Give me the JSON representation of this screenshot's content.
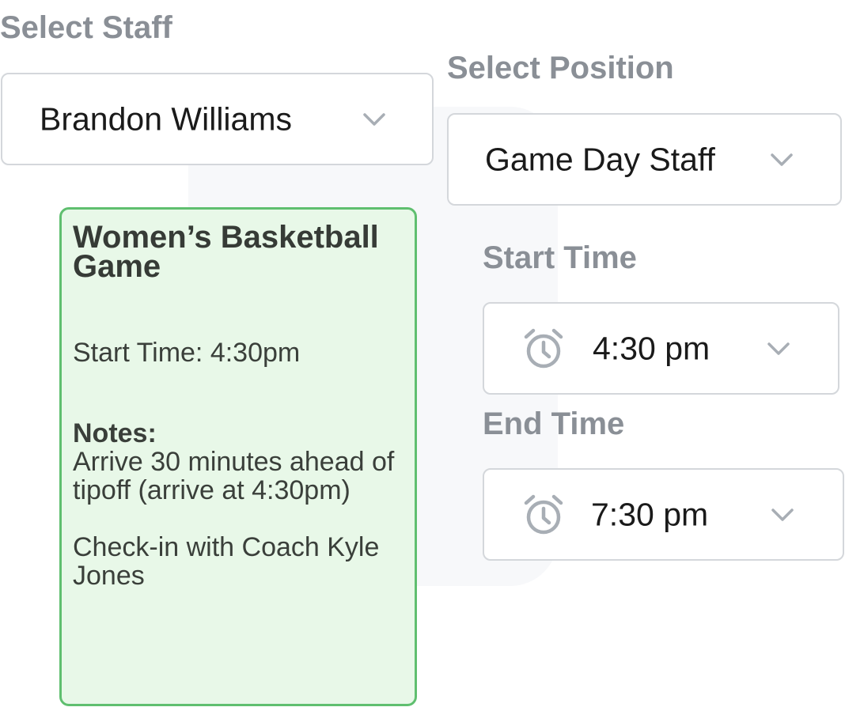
{
  "staff": {
    "label": "Select Staff",
    "value": "Brandon Williams"
  },
  "position": {
    "label": "Select Position",
    "value": "Game Day Staff"
  },
  "start_time": {
    "label": "Start Time",
    "value": "4:30 pm"
  },
  "end_time": {
    "label": "End Time",
    "value": "7:30 pm"
  },
  "event_card": {
    "title": "Women’s Basketball Game",
    "start": "Start Time: 4:30pm",
    "notes_label": "Notes:",
    "notes": "Arrive 30 minutes ahead of tipoff (arrive at 4:30pm)",
    "checkin": "Check-in with Coach Kyle Jones"
  },
  "icons": {
    "dropdown": "chevron-down-icon",
    "time": "alarm-clock-icon"
  },
  "colors": {
    "label": "#8a8f96",
    "card_bg": "#e8f8e8",
    "card_border": "#5fbf6f",
    "field_border": "#d4d7db",
    "icon": "#a8aeb5"
  }
}
